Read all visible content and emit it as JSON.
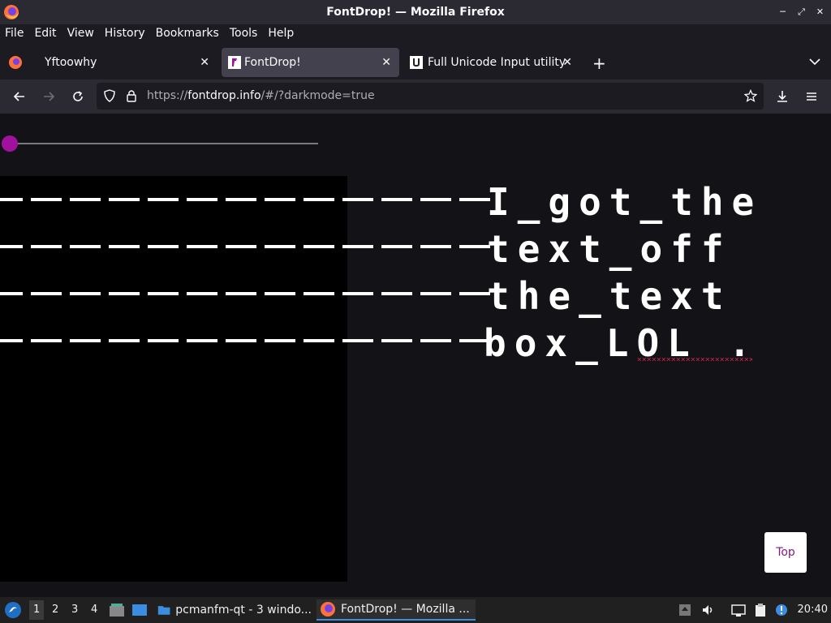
{
  "window": {
    "title": "FontDrop! — Mozilla Firefox"
  },
  "menu": [
    "File",
    "Edit",
    "View",
    "History",
    "Bookmarks",
    "Tools",
    "Help"
  ],
  "tabs": [
    {
      "label": "Yftoowhy",
      "close": "✕"
    },
    {
      "label": "FontDrop!",
      "close": "✕"
    },
    {
      "label": "Full Unicode Input utility",
      "close": "✕"
    }
  ],
  "newtab": "+",
  "url": {
    "prefix": "https://",
    "host": "fontdrop.info",
    "path": "/#/?darkmode=true"
  },
  "page": {
    "slider": {
      "value": 0
    },
    "lines": [
      "I_got_the",
      "text_off",
      "the_text",
      "box_LOL ."
    ],
    "top_button": "Top"
  },
  "taskbar": {
    "workspaces": [
      "1",
      "2",
      "3",
      "4"
    ],
    "apps": [
      "pcmanfm-qt - 3 windo...",
      "FontDrop! — Mozilla ..."
    ],
    "clock": "20:40"
  }
}
